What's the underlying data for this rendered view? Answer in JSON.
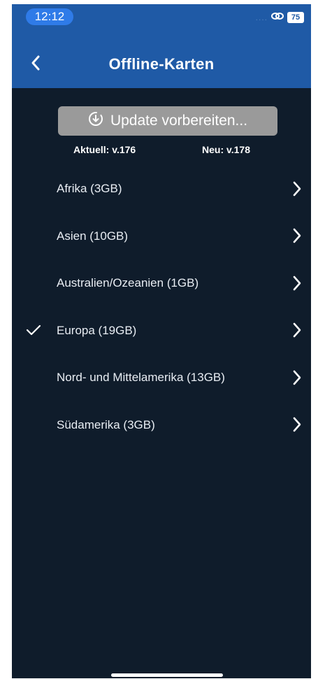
{
  "status_bar": {
    "time": "12:12",
    "signal": "....",
    "battery": "75",
    "link_icon": "link-icon"
  },
  "header": {
    "title": "Offline-Karten",
    "back_icon": "chevron-left-icon"
  },
  "update": {
    "label": "Update vorbereiten...",
    "icon": "download-circle-icon"
  },
  "versions": {
    "current": "Aktuell: v.176",
    "new": "Neu: v.178"
  },
  "regions": [
    {
      "label": "Afrika (3GB)",
      "selected": false
    },
    {
      "label": "Asien (10GB)",
      "selected": false
    },
    {
      "label": "Australien/Ozeanien (1GB)",
      "selected": false
    },
    {
      "label": "Europa (19GB)",
      "selected": true
    },
    {
      "label": "Nord- und Mittelamerika (13GB)",
      "selected": false
    },
    {
      "label": "Südamerika (3GB)",
      "selected": false
    }
  ],
  "colors": {
    "header_bg": "#1f5aa6",
    "body_bg": "#0f1c2b",
    "button_disabled": "#9a9a9a",
    "time_pill": "#2f7be8"
  }
}
